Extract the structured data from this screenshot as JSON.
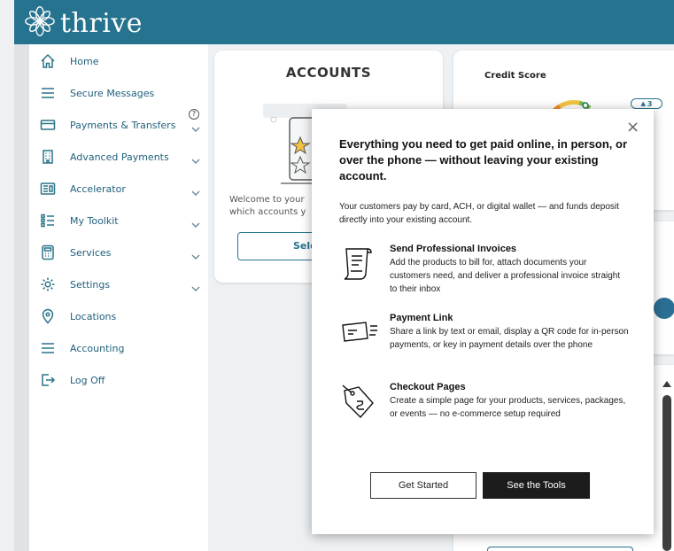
{
  "app": {
    "logo_text": "thrive",
    "logo_icon": "flower-logo-icon"
  },
  "sidebar": {
    "items": [
      {
        "label": "Home",
        "icon": "home-icon",
        "chevron": false
      },
      {
        "label": "Secure Messages",
        "icon": "menu-icon",
        "chevron": false
      },
      {
        "label": "Payments & Transfers",
        "icon": "card-icon",
        "chevron": true
      },
      {
        "label": "Advanced Payments",
        "icon": "building-icon",
        "chevron": true
      },
      {
        "label": "Accelerator",
        "icon": "screen-icon",
        "chevron": true
      },
      {
        "label": "My Toolkit",
        "icon": "list-icon",
        "chevron": true
      },
      {
        "label": "Services",
        "icon": "calculator-icon",
        "chevron": true
      },
      {
        "label": "Settings",
        "icon": "gear-icon",
        "chevron": true
      },
      {
        "label": "Locations",
        "icon": "location-pin-icon",
        "chevron": false
      },
      {
        "label": "Accounting",
        "icon": "menu-icon",
        "chevron": false
      },
      {
        "label": "Log Off",
        "icon": "logout-icon",
        "chevron": false
      }
    ],
    "help_badge": "?"
  },
  "accounts_card": {
    "title": "ACCOUNTS",
    "welcome_text": "Welcome to your",
    "welcome_text_2": "which accounts y",
    "select_button": "Sele"
  },
  "credit_card": {
    "title": "Credit Score",
    "notification_count": "3"
  },
  "modal": {
    "close": "×",
    "heading": "Everything you need to get paid online, in person, or over the phone — without leaving your existing account.",
    "intro": "Your customers pay by card, ACH, or digital wallet — and funds deposit directly into your existing account.",
    "features": [
      {
        "title": "Send Professional Invoices",
        "text": "Add the products to bill for, attach documents your customers need, and deliver a professional invoice straight to their inbox",
        "icon": "invoice-icon"
      },
      {
        "title": "Payment Link",
        "text": "Share a link by text or email, display a QR code for in-person payments, or key in payment details over the phone",
        "icon": "payment-card-icon"
      },
      {
        "title": "Checkout Pages",
        "text": "Create a simple page for your products, services, packages, or events — no e-commerce setup required",
        "icon": "price-tag-icon"
      }
    ],
    "get_started": "Get Started",
    "see_tools": "See the Tools"
  },
  "colors": {
    "brand": "#26738f",
    "sidebar_text": "#1f5f7a",
    "primary_button": "#1c1c1c"
  }
}
